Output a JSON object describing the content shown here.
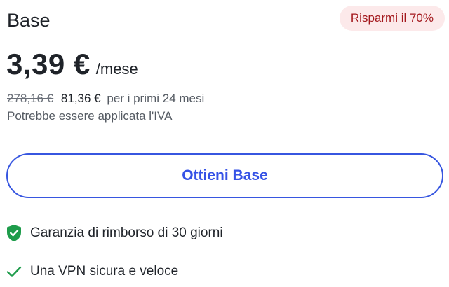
{
  "plan": {
    "name": "Base",
    "badge": "Risparmi il 70%",
    "price": "3,39 €",
    "period": "/mese",
    "old_price": "278,16 €",
    "new_price": "81,36 €",
    "billing_suffix": "per i primi 24 mesi",
    "vat_note": "Potrebbe essere applicata l'IVA"
  },
  "cta": {
    "label": "Ottieni Base"
  },
  "features": [
    {
      "icon": "shield-check-icon",
      "label": "Garanzia di rimborso di 30 giorni"
    },
    {
      "icon": "checkmark-icon",
      "label": "Una VPN sicura e veloce"
    }
  ],
  "colors": {
    "accent": "#3552e6",
    "badge_bg": "#fce9ea",
    "badge_text": "#a3171c",
    "success": "#1e9c4b"
  }
}
